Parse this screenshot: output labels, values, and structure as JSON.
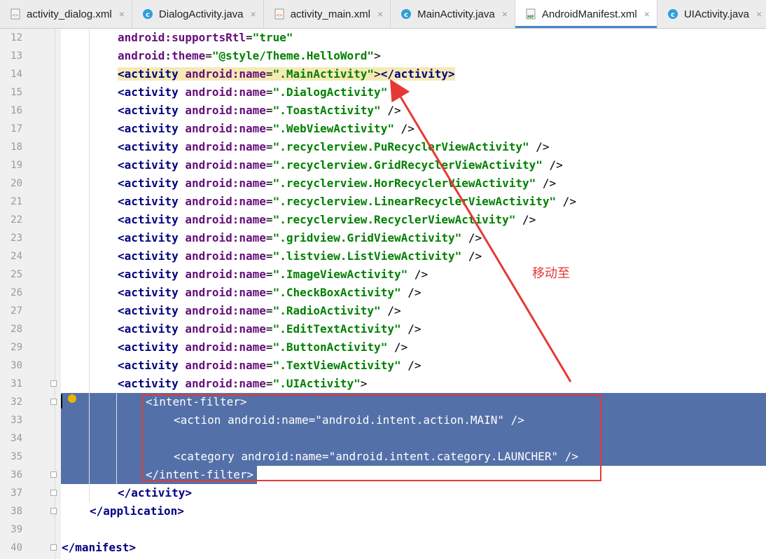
{
  "tabs": [
    {
      "label": "activity_dialog.xml",
      "icon": "xml-file-icon",
      "active": false
    },
    {
      "label": "DialogActivity.java",
      "icon": "java-class-icon",
      "active": false
    },
    {
      "label": "activity_main.xml",
      "icon": "xml-file-icon",
      "active": false
    },
    {
      "label": "MainActivity.java",
      "icon": "java-class-icon",
      "active": false
    },
    {
      "label": "AndroidManifest.xml",
      "icon": "manifest-file-icon",
      "active": true
    },
    {
      "label": "UIActivity.java",
      "icon": "java-class-icon",
      "active": false
    }
  ],
  "close_glyph": "×",
  "annotation": "移动至",
  "colors": {
    "selection": "#5470a8",
    "annotation": "#e53935",
    "tag": "#000080",
    "attr": "#660e7a",
    "value": "#008000"
  },
  "lines": [
    {
      "n": "12",
      "indent": 8,
      "tokens": [
        [
          "attr",
          "android:supportsRtl"
        ],
        [
          "plain",
          "="
        ],
        [
          "val",
          "\"true\""
        ]
      ]
    },
    {
      "n": "13",
      "indent": 8,
      "tokens": [
        [
          "attr",
          "android:theme"
        ],
        [
          "plain",
          "="
        ],
        [
          "val",
          "\"@style/Theme.HelloWord\""
        ],
        [
          "plain",
          ">"
        ]
      ]
    },
    {
      "n": "14",
      "indent": 8,
      "hl": true,
      "tokens": [
        [
          "tag",
          "<activity "
        ],
        [
          "attr",
          "android:name"
        ],
        [
          "plain",
          "="
        ],
        [
          "val",
          "\".MainActivity\""
        ],
        [
          "plain",
          ">"
        ],
        [
          "tag",
          "</activity>"
        ]
      ]
    },
    {
      "n": "15",
      "indent": 8,
      "tokens": [
        [
          "tag",
          "<activity "
        ],
        [
          "attr",
          "android:name"
        ],
        [
          "plain",
          "="
        ],
        [
          "val",
          "\".DialogActivity\""
        ],
        [
          "plain",
          " />"
        ]
      ]
    },
    {
      "n": "16",
      "indent": 8,
      "tokens": [
        [
          "tag",
          "<activity "
        ],
        [
          "attr",
          "android:name"
        ],
        [
          "plain",
          "="
        ],
        [
          "val",
          "\".ToastActivity\""
        ],
        [
          "plain",
          " />"
        ]
      ]
    },
    {
      "n": "17",
      "indent": 8,
      "tokens": [
        [
          "tag",
          "<activity "
        ],
        [
          "attr",
          "android:name"
        ],
        [
          "plain",
          "="
        ],
        [
          "val",
          "\".WebViewActivity\""
        ],
        [
          "plain",
          " />"
        ]
      ]
    },
    {
      "n": "18",
      "indent": 8,
      "tokens": [
        [
          "tag",
          "<activity "
        ],
        [
          "attr",
          "android:name"
        ],
        [
          "plain",
          "="
        ],
        [
          "val",
          "\".recyclerview.PuRecyclerViewActivity\""
        ],
        [
          "plain",
          " />"
        ]
      ]
    },
    {
      "n": "19",
      "indent": 8,
      "tokens": [
        [
          "tag",
          "<activity "
        ],
        [
          "attr",
          "android:name"
        ],
        [
          "plain",
          "="
        ],
        [
          "val",
          "\".recyclerview.GridRecyclerViewActivity\""
        ],
        [
          "plain",
          " />"
        ]
      ]
    },
    {
      "n": "20",
      "indent": 8,
      "tokens": [
        [
          "tag",
          "<activity "
        ],
        [
          "attr",
          "android:name"
        ],
        [
          "plain",
          "="
        ],
        [
          "val",
          "\".recyclerview.HorRecyclerViewActivity\""
        ],
        [
          "plain",
          " />"
        ]
      ]
    },
    {
      "n": "21",
      "indent": 8,
      "tokens": [
        [
          "tag",
          "<activity "
        ],
        [
          "attr",
          "android:name"
        ],
        [
          "plain",
          "="
        ],
        [
          "val",
          "\".recyclerview.LinearRecyclerViewActivity\""
        ],
        [
          "plain",
          " />"
        ]
      ]
    },
    {
      "n": "22",
      "indent": 8,
      "tokens": [
        [
          "tag",
          "<activity "
        ],
        [
          "attr",
          "android:name"
        ],
        [
          "plain",
          "="
        ],
        [
          "val",
          "\".recyclerview.RecyclerViewActivity\""
        ],
        [
          "plain",
          " />"
        ]
      ]
    },
    {
      "n": "23",
      "indent": 8,
      "tokens": [
        [
          "tag",
          "<activity "
        ],
        [
          "attr",
          "android:name"
        ],
        [
          "plain",
          "="
        ],
        [
          "val",
          "\".gridview.GridViewActivity\""
        ],
        [
          "plain",
          " />"
        ]
      ]
    },
    {
      "n": "24",
      "indent": 8,
      "tokens": [
        [
          "tag",
          "<activity "
        ],
        [
          "attr",
          "android:name"
        ],
        [
          "plain",
          "="
        ],
        [
          "val",
          "\".listview.ListViewActivity\""
        ],
        [
          "plain",
          " />"
        ]
      ]
    },
    {
      "n": "25",
      "indent": 8,
      "tokens": [
        [
          "tag",
          "<activity "
        ],
        [
          "attr",
          "android:name"
        ],
        [
          "plain",
          "="
        ],
        [
          "val",
          "\".ImageViewActivity\""
        ],
        [
          "plain",
          " />"
        ]
      ]
    },
    {
      "n": "26",
      "indent": 8,
      "tokens": [
        [
          "tag",
          "<activity "
        ],
        [
          "attr",
          "android:name"
        ],
        [
          "plain",
          "="
        ],
        [
          "val",
          "\".CheckBoxActivity\""
        ],
        [
          "plain",
          " />"
        ]
      ]
    },
    {
      "n": "27",
      "indent": 8,
      "tokens": [
        [
          "tag",
          "<activity "
        ],
        [
          "attr",
          "android:name"
        ],
        [
          "plain",
          "="
        ],
        [
          "val",
          "\".RadioActivity\""
        ],
        [
          "plain",
          " />"
        ]
      ]
    },
    {
      "n": "28",
      "indent": 8,
      "tokens": [
        [
          "tag",
          "<activity "
        ],
        [
          "attr",
          "android:name"
        ],
        [
          "plain",
          "="
        ],
        [
          "val",
          "\".EditTextActivity\""
        ],
        [
          "plain",
          " />"
        ]
      ]
    },
    {
      "n": "29",
      "indent": 8,
      "tokens": [
        [
          "tag",
          "<activity "
        ],
        [
          "attr",
          "android:name"
        ],
        [
          "plain",
          "="
        ],
        [
          "val",
          "\".ButtonActivity\""
        ],
        [
          "plain",
          " />"
        ]
      ]
    },
    {
      "n": "30",
      "indent": 8,
      "tokens": [
        [
          "tag",
          "<activity "
        ],
        [
          "attr",
          "android:name"
        ],
        [
          "plain",
          "="
        ],
        [
          "val",
          "\".TextViewActivity\""
        ],
        [
          "plain",
          " />"
        ]
      ]
    },
    {
      "n": "31",
      "indent": 8,
      "tokens": [
        [
          "tag",
          "<activity "
        ],
        [
          "attr",
          "android:name"
        ],
        [
          "plain",
          "="
        ],
        [
          "val",
          "\".UIActivity\""
        ],
        [
          "plain",
          ">"
        ]
      ]
    },
    {
      "n": "32",
      "indent": 12,
      "sel": true,
      "tokens": [
        [
          "tag",
          "<intent-filter"
        ],
        [
          "plain",
          ">"
        ]
      ]
    },
    {
      "n": "33",
      "indent": 16,
      "sel": true,
      "tokens": [
        [
          "tag",
          "<action "
        ],
        [
          "attr",
          "android:name"
        ],
        [
          "plain",
          "="
        ],
        [
          "val",
          "\"android.intent.action.MAIN\""
        ],
        [
          "plain",
          " />"
        ]
      ]
    },
    {
      "n": "34",
      "indent": 0,
      "sel": true,
      "tokens": []
    },
    {
      "n": "35",
      "indent": 16,
      "sel": true,
      "tokens": [
        [
          "tag",
          "<category "
        ],
        [
          "attr",
          "android:name"
        ],
        [
          "plain",
          "="
        ],
        [
          "val",
          "\"android.intent.category.LAUNCHER\""
        ],
        [
          "plain",
          " />"
        ]
      ]
    },
    {
      "n": "36",
      "indent": 12,
      "sel": "partial",
      "tokens": [
        [
          "tag",
          "</intent-filter>"
        ]
      ]
    },
    {
      "n": "37",
      "indent": 8,
      "tokens": [
        [
          "tag",
          "</activity>"
        ]
      ]
    },
    {
      "n": "38",
      "indent": 4,
      "tokens": [
        [
          "tag",
          "</application>"
        ]
      ]
    },
    {
      "n": "39",
      "indent": 0,
      "tokens": []
    },
    {
      "n": "40",
      "indent": 0,
      "tokens": [
        [
          "tag",
          "</manifest>"
        ]
      ]
    }
  ]
}
